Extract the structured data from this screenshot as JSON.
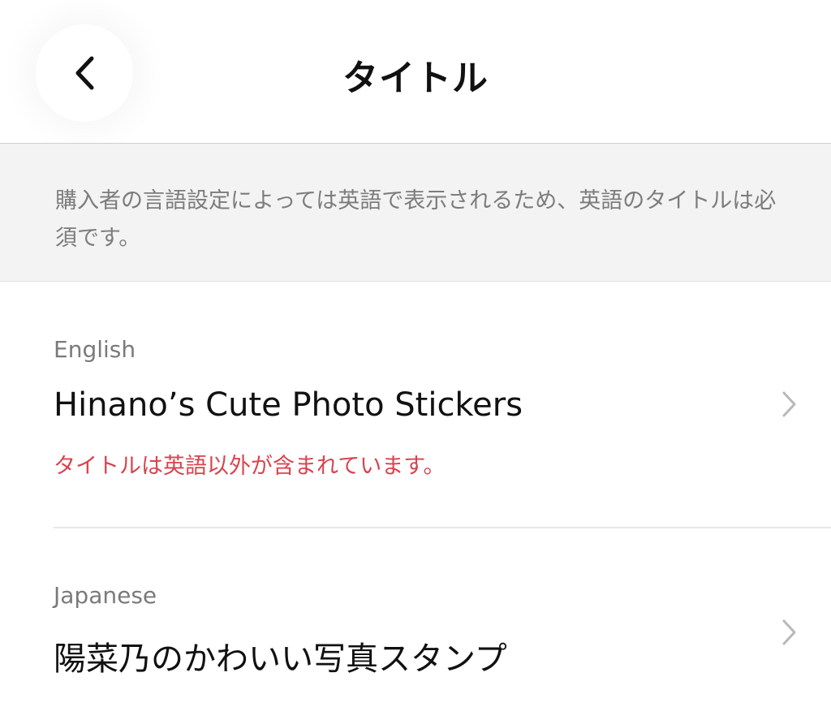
{
  "header": {
    "back_icon": "chevron-left-icon",
    "title": "タイトル"
  },
  "notice": {
    "text": "購入者の言語設定によっては英語で表示されるため、英語のタイトルは必須です。"
  },
  "rows": [
    {
      "label": "English",
      "value": "Hinano’s Cute Photo Stickers",
      "error": "タイトルは英語以外が含まれています。",
      "icon": "chevron-right-icon"
    },
    {
      "label": "Japanese",
      "value": "陽菜乃のかわいい写真スタンプ",
      "icon": "chevron-right-icon"
    }
  ],
  "colors": {
    "error": "#d9434f",
    "notice_background": "#f3f3f3",
    "secondary_text": "#7a7a7a"
  }
}
